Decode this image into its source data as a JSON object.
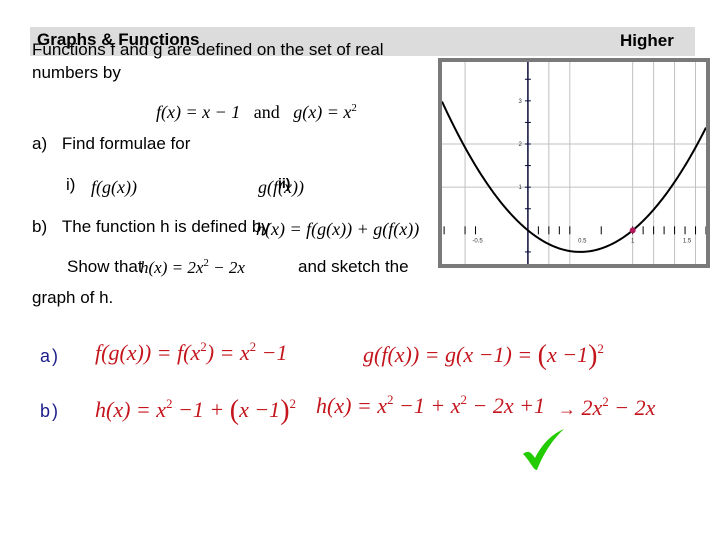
{
  "header": {
    "title": "Graphs & Functions",
    "level": "Higher"
  },
  "question": {
    "intro_line1": "Functions  f  and  g are defined on the set of real",
    "intro_line2": "numbers by",
    "definitions": {
      "f_def": "f(x) = x − 1",
      "and": "and",
      "g_def_base": "g(x) = x",
      "g_def_exp": "2"
    },
    "part_a": {
      "label": "a)",
      "text": "Find formulae for",
      "i_label": "i)",
      "i_expr": "f(g(x))",
      "ii_label": "ii)",
      "ii_expr": "g(f(x))"
    },
    "part_b": {
      "label": "b)",
      "text": "The function  h  is defined by",
      "h_def": "h(x) = f(g(x)) + g(f(x))",
      "show_that": "Show that",
      "show_expr_a": "h(x) = 2x",
      "show_expr_exp": "2",
      "show_expr_b": " − 2x",
      "sketch_text": "and sketch the",
      "line3": "graph of  h."
    }
  },
  "answers": {
    "a": {
      "label": "a)",
      "fg_1": "f(g(x)) = f(x",
      "fg_1_exp": "2",
      "fg_2": ") = x",
      "fg_2_exp": "2",
      "fg_3": " −1",
      "gf_1": "g(f(x)) = g(x −1) = ",
      "gf_paren_open": "(",
      "gf_inner": "x −1",
      "gf_paren_close": ")",
      "gf_exp": "2"
    },
    "b": {
      "label": "b)",
      "h1_a": "h(x) = x",
      "h1_exp1": "2",
      "h1_b": " −1 + ",
      "h1_paren_open": "(",
      "h1_inner": "x −1",
      "h1_paren_close": ")",
      "h1_exp2": "2",
      "h2_a": "h(x) = x",
      "h2_exp1": "2",
      "h2_b": " −1 + x",
      "h2_exp2": "2",
      "h2_c": " − 2x +1",
      "arrow": "→",
      "h3_a": "2x",
      "h3_exp": "2",
      "h3_b": " − 2x"
    },
    "check_icon": "checkmark-icon",
    "colors": {
      "answer": "#c4141c",
      "label": "#1c1c8c",
      "check": "#22cc00"
    }
  },
  "chart_data": {
    "type": "line",
    "title": "",
    "function": "h(x) = 2x^2 - 2x",
    "xlabel": "",
    "ylabel": "",
    "xlim": [
      -0.82,
      1.7
    ],
    "ylim": [
      -0.78,
      3.9
    ],
    "x_tick_labels": [
      "-0.5",
      "0.5",
      "1",
      "1.5"
    ],
    "x_tick_values": [
      -0.5,
      0.5,
      1,
      1.5
    ],
    "y_tick_labels": [
      "1",
      "2",
      "3"
    ],
    "y_tick_values": [
      1,
      2,
      3
    ],
    "grid": true,
    "series": [
      {
        "name": "h(x)",
        "x": [
          -0.8,
          -0.6,
          -0.4,
          -0.2,
          0,
          0.2,
          0.4,
          0.5,
          0.6,
          0.8,
          1.0,
          1.2,
          1.4,
          1.6,
          1.7
        ],
        "y": [
          2.88,
          1.92,
          1.12,
          0.48,
          0,
          -0.32,
          -0.48,
          -0.5,
          -0.48,
          -0.32,
          0,
          0.48,
          1.12,
          1.92,
          2.38
        ]
      }
    ],
    "highlighted_point": {
      "x": 1,
      "y": 0,
      "color": "#b0185a"
    },
    "curve_color": "#000000",
    "axis_color": "#0a0a3c",
    "grid_color": "#c0c0c0"
  }
}
